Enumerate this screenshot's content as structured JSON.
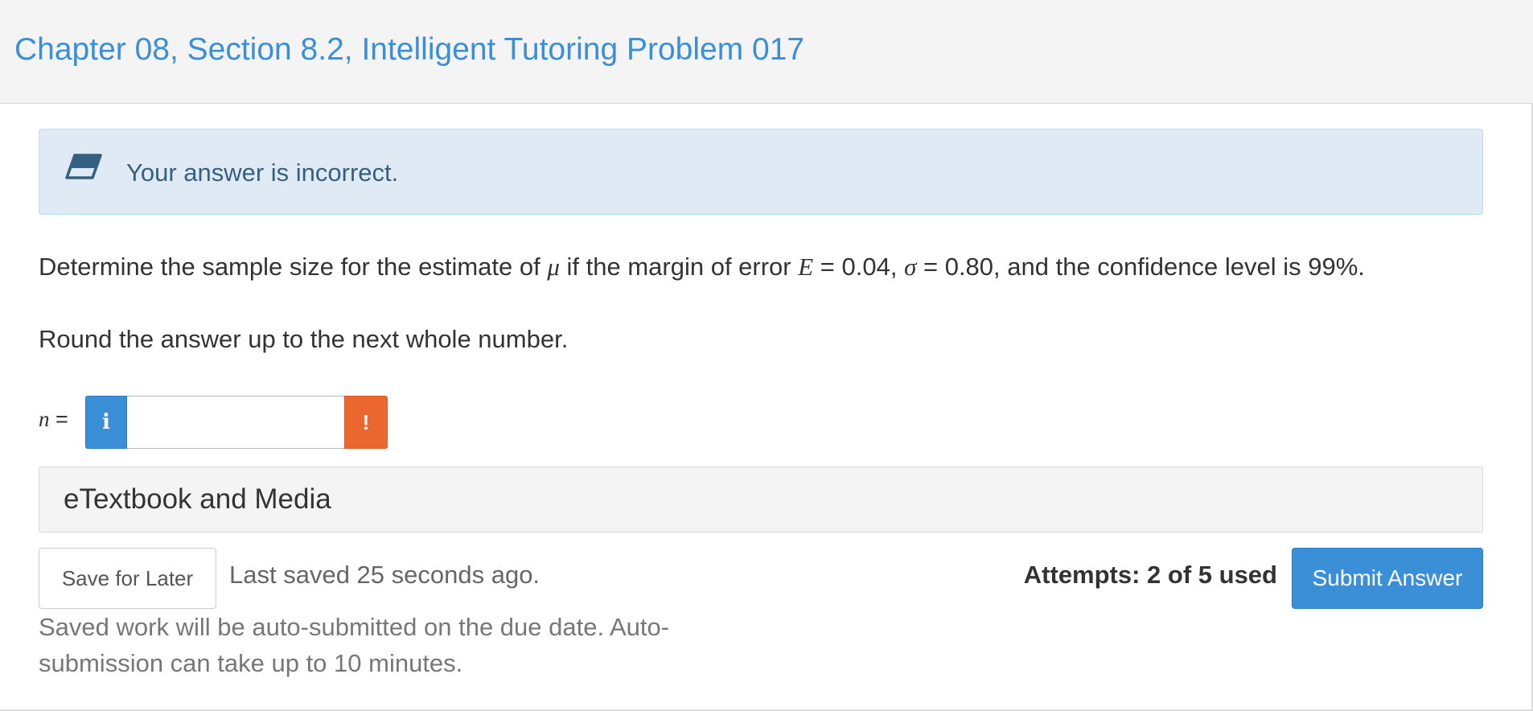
{
  "header": {
    "title": "Chapter 08, Section 8.2, Intelligent Tutoring Problem 017"
  },
  "alert": {
    "icon": "eraser-icon",
    "message": "Your answer is incorrect."
  },
  "question": {
    "part1": "Determine the sample size for the estimate of ",
    "mu": "μ",
    "part2": " if the margin of error ",
    "E": "E",
    "part3": " = 0.04, ",
    "sigma": "σ",
    "part4": " = 0.80, and the confidence level is 99%.",
    "instruction": "Round the answer up to the next whole number."
  },
  "answer": {
    "var": "n",
    "eq": " =",
    "info_icon": "i",
    "value": "",
    "warn_icon": "!"
  },
  "etextbook": {
    "label": "eTextbook and Media"
  },
  "footer": {
    "save_label": "Save for Later",
    "last_saved": "Last saved 25 seconds ago.",
    "auto_note": "Saved work will be auto-submitted on the due date. Auto-submission can take up to 10 minutes.",
    "attempts": "Attempts: 2 of 5 used",
    "submit_label": "Submit Answer"
  },
  "colors": {
    "accent": "#3a8fd6",
    "alert_bg": "#dfeaf5",
    "warn": "#ec6630"
  }
}
